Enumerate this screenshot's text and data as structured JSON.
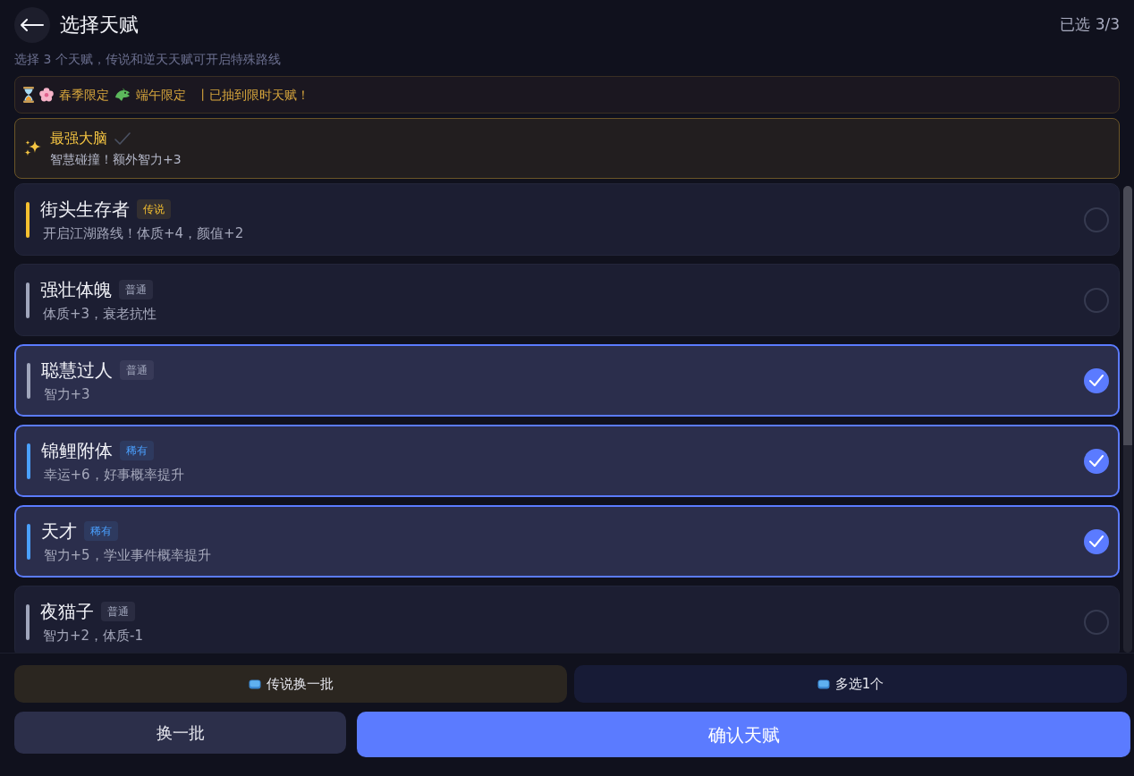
{
  "header": {
    "title": "选择天赋",
    "counter": "已选 3/3"
  },
  "subtitle": "选择 3 个天赋，传说和逆天天赋可开启特殊路线",
  "limited_banner": {
    "events": [
      {
        "kind": "spring",
        "label": "春季限定"
      },
      {
        "kind": "dragon_boat",
        "label": "端午限定"
      }
    ],
    "message": "丨已抽到限时天赋！"
  },
  "combo": {
    "name": "最强大脑",
    "checked": true,
    "description": "智慧碰撞！额外智力+3"
  },
  "talents": [
    {
      "name": "街头生存者",
      "rarity": "传说",
      "color": "#f5c030",
      "description": "开启江湖路线！体质+4，颜值+2",
      "selected": false
    },
    {
      "name": "强壮体魄",
      "rarity": "普通",
      "color": "#a0a6bc",
      "description": "体质+3，衰老抗性",
      "selected": false
    },
    {
      "name": "聪慧过人",
      "rarity": "普通",
      "color": "#a0a6bc",
      "description": "智力+3",
      "selected": true
    },
    {
      "name": "锦鲤附体",
      "rarity": "稀有",
      "color": "#4aa0ff",
      "description": "幸运+6，好事概率提升",
      "selected": true
    },
    {
      "name": "天才",
      "rarity": "稀有",
      "color": "#4aa0ff",
      "description": "智力+5，学业事件概率提升",
      "selected": true
    },
    {
      "name": "夜猫子",
      "rarity": "普通",
      "color": "#a0a6bc",
      "description": "智力+2，体质-1",
      "selected": false
    }
  ],
  "extra_actions": [
    {
      "kind": "legend",
      "label": "传说换一批"
    },
    {
      "kind": "bonus",
      "label": "多选1个"
    }
  ],
  "main_actions": [
    {
      "kind": "secondary",
      "label": "换一批"
    },
    {
      "kind": "primary",
      "label": "确认天赋"
    }
  ]
}
